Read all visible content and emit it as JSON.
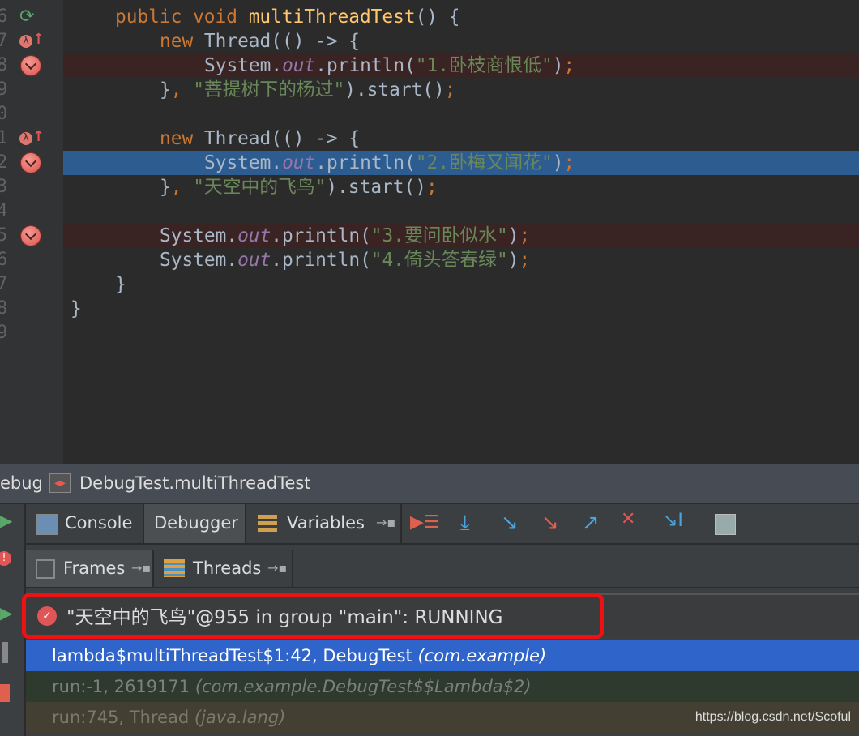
{
  "editor": {
    "line_numbers": [
      "6",
      "7",
      "8",
      "9",
      "0",
      "1",
      "2",
      "3",
      "4",
      "5",
      "6",
      "7",
      "8",
      "9"
    ],
    "lines": [
      {
        "indent": 1,
        "tokens": [
          {
            "c": "kw",
            "t": "public void "
          },
          {
            "c": "fn",
            "t": "multiThreadTest"
          },
          {
            "c": "",
            "t": "() {"
          }
        ]
      },
      {
        "indent": 2,
        "tokens": [
          {
            "c": "kw",
            "t": "new "
          },
          {
            "c": "",
            "t": "Thread(() -> {"
          }
        ]
      },
      {
        "indent": 3,
        "tokens": [
          {
            "c": "",
            "t": "System."
          },
          {
            "c": "fld",
            "t": "out"
          },
          {
            "c": "",
            "t": ".println("
          },
          {
            "c": "str",
            "t": "\"1.卧枝商恨低\""
          },
          {
            "c": "",
            "t": ")"
          },
          {
            "c": "kw",
            "t": ";"
          }
        ]
      },
      {
        "indent": 2,
        "tokens": [
          {
            "c": "",
            "t": "}"
          },
          {
            "c": "kw",
            "t": ", "
          },
          {
            "c": "str",
            "t": "\"菩提树下的杨过\""
          },
          {
            "c": "",
            "t": ").start()"
          },
          {
            "c": "kw",
            "t": ";"
          }
        ]
      },
      {
        "indent": 0,
        "tokens": []
      },
      {
        "indent": 2,
        "tokens": [
          {
            "c": "kw",
            "t": "new "
          },
          {
            "c": "",
            "t": "Thread(() -> {"
          }
        ]
      },
      {
        "indent": 3,
        "tokens": [
          {
            "c": "",
            "t": "System."
          },
          {
            "c": "fld",
            "t": "out"
          },
          {
            "c": "",
            "t": ".println("
          },
          {
            "c": "str",
            "t": "\"2.卧梅又闻花\""
          },
          {
            "c": "",
            "t": ")"
          },
          {
            "c": "kw",
            "t": ";"
          }
        ]
      },
      {
        "indent": 2,
        "tokens": [
          {
            "c": "",
            "t": "}"
          },
          {
            "c": "kw",
            "t": ", "
          },
          {
            "c": "str",
            "t": "\"天空中的飞鸟\""
          },
          {
            "c": "",
            "t": ").start()"
          },
          {
            "c": "kw",
            "t": ";"
          }
        ]
      },
      {
        "indent": 0,
        "tokens": []
      },
      {
        "indent": 2,
        "tokens": [
          {
            "c": "",
            "t": "System."
          },
          {
            "c": "fld",
            "t": "out"
          },
          {
            "c": "",
            "t": ".println("
          },
          {
            "c": "str",
            "t": "\"3.要问卧似水\""
          },
          {
            "c": "",
            "t": ")"
          },
          {
            "c": "kw",
            "t": ";"
          }
        ]
      },
      {
        "indent": 2,
        "tokens": [
          {
            "c": "",
            "t": "System."
          },
          {
            "c": "fld",
            "t": "out"
          },
          {
            "c": "",
            "t": ".println("
          },
          {
            "c": "str",
            "t": "\"4.倚头答春绿\""
          },
          {
            "c": "",
            "t": ")"
          },
          {
            "c": "kw",
            "t": ";"
          }
        ]
      },
      {
        "indent": 1,
        "tokens": [
          {
            "c": "",
            "t": "}"
          }
        ]
      },
      {
        "indent": 0,
        "tokens": [
          {
            "c": "",
            "t": "}"
          }
        ]
      },
      {
        "indent": 0,
        "tokens": []
      }
    ],
    "breakpoint_lines": [
      2,
      6,
      9
    ],
    "lambda_lines": [
      1,
      5
    ],
    "current_line": 6
  },
  "debug": {
    "title": "ebug",
    "config": "DebugTest.multiThreadTest",
    "tabs": {
      "console": "Console",
      "debugger": "Debugger",
      "variables": "Variables"
    },
    "subtabs": {
      "frames": "Frames",
      "threads": "Threads"
    },
    "thread": "\"天空中的飞鸟\"@955 in group \"main\": RUNNING",
    "frames": [
      {
        "text": "lambda$multiThreadTest$1:42, DebugTest ",
        "pkg": "(com.example)"
      },
      {
        "text": "run:-1, 2619171 ",
        "pkg": "(com.example.DebugTest$$Lambda$2)"
      },
      {
        "text": "run:745, Thread ",
        "pkg": "(java.lang)"
      }
    ]
  },
  "watermark": "https://blog.csdn.net/Scoful"
}
